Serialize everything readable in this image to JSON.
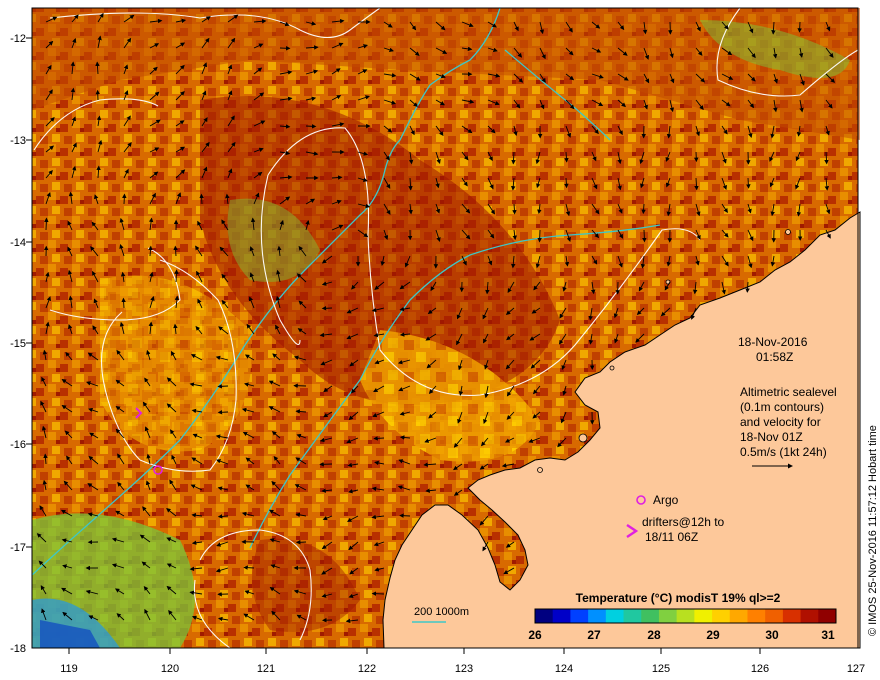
{
  "map": {
    "x_ticks": [
      "119",
      "120",
      "121",
      "122",
      "123",
      "124",
      "125",
      "126",
      "127"
    ],
    "y_ticks": [
      "-12",
      "-13",
      "-14",
      "-15",
      "-16",
      "-17",
      "-18"
    ]
  },
  "annotations": {
    "date": "18-Nov-2016",
    "time": "01:58Z",
    "desc_lines": [
      "Altimetric sealevel",
      "(0.1m contours)",
      "and velocity for",
      "18-Nov 01Z",
      "0.5m/s (1kt 24h)"
    ],
    "argo_label": "Argo",
    "drifters_line1": "drifters@12h to",
    "drifters_line2": "18/11 06Z",
    "depth_legend": "200  1000m"
  },
  "colorbar": {
    "title": "Temperature  (°C) modisT 19% ql>=2",
    "ticks": [
      "26",
      "27",
      "28",
      "29",
      "30",
      "31"
    ]
  },
  "credit": "© IMOS 25-Nov-2016 11:57:12 Hobart time",
  "colors": {
    "land": "#fdc89a",
    "sst_warm": "#d35400",
    "sst_hot": "#a01800",
    "sst_mid": "#f0a000",
    "sst_green": "#7ac63a",
    "contour": "#ffffff",
    "isobath": "#3ec7c7",
    "argo": "#e020e0"
  }
}
